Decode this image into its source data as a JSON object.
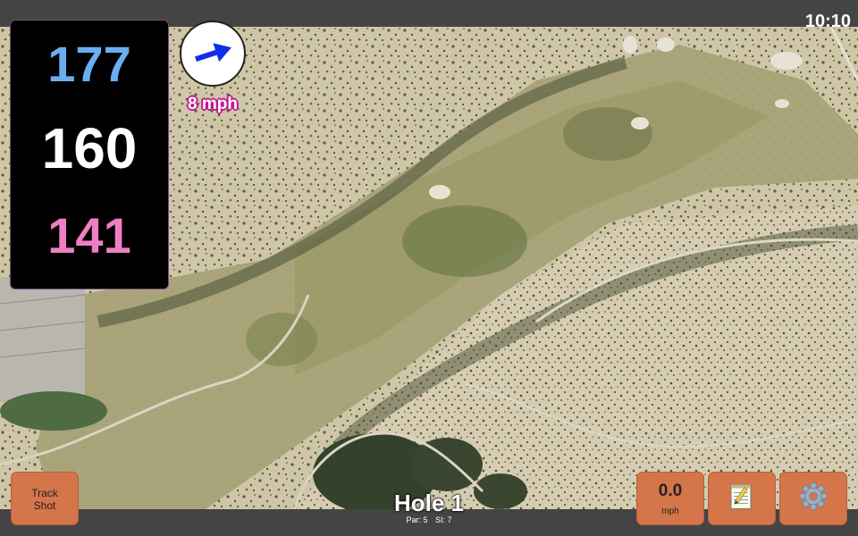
{
  "status": {
    "time": "10:10"
  },
  "distances": {
    "back": "177",
    "middle": "160",
    "front": "141"
  },
  "wind": {
    "speed_label": "8 mph",
    "icon": "arrow-right-icon"
  },
  "buttons": {
    "track_shot": {
      "line1": "Track",
      "line2": "Shot"
    },
    "speed": {
      "value": "0.0",
      "unit": "mph"
    },
    "notes": {
      "icon": "notepad-icon"
    },
    "settings": {
      "icon": "gear-icon"
    }
  },
  "hole": {
    "title": "Hole 1",
    "par": "Par: 5",
    "si": "SI: 7"
  },
  "colors": {
    "back_distance": "#6aaef2",
    "middle_distance": "#ffffff",
    "front_distance": "#f07ec2",
    "button": "#d4754a",
    "wind_label_outline": "#c2188e"
  }
}
